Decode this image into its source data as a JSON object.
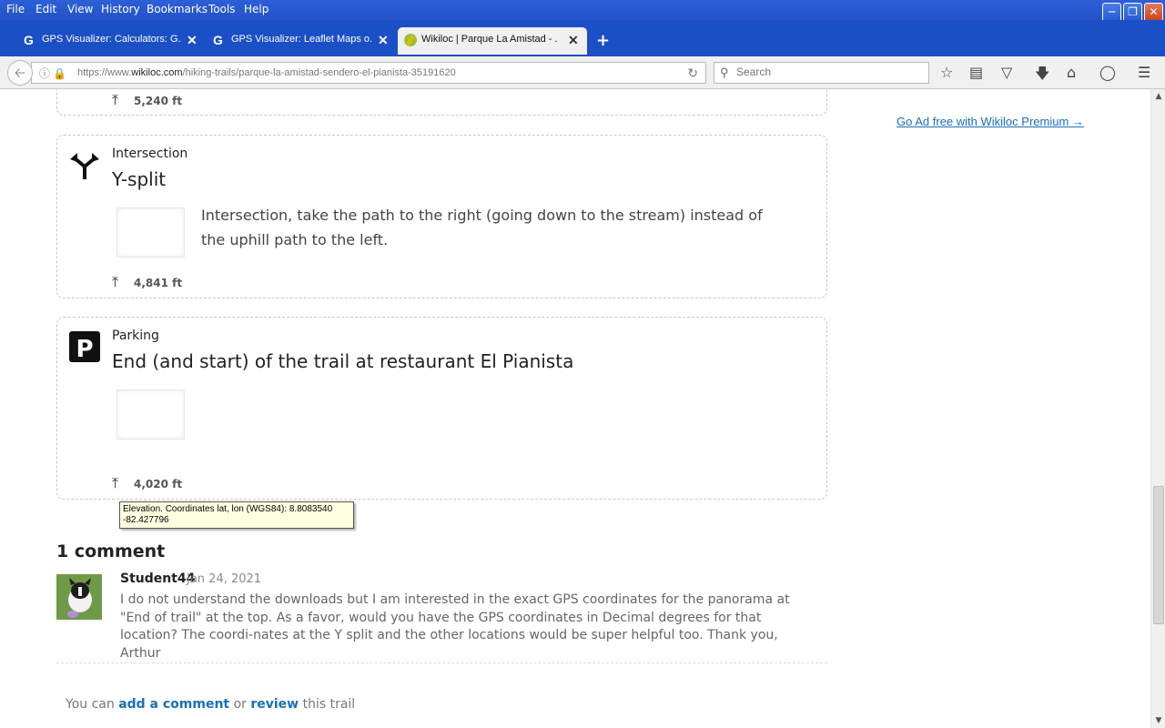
{
  "menu": {
    "file": "File",
    "edit": "Edit",
    "view": "View",
    "history": "History",
    "bookmarks": "Bookmarks",
    "tools": "Tools",
    "help": "Help"
  },
  "tabs": [
    {
      "label": "GPS Visualizer: Calculators: G...",
      "icon": "G"
    },
    {
      "label": "GPS Visualizer: Leaflet Maps o...",
      "icon": "G"
    },
    {
      "label": "Wikiloc | Parque La Amistad - ...",
      "icon": "wikiloc-icon"
    }
  ],
  "navbar": {
    "url_prefix": "https://www.",
    "url_domain": "wikiloc.com",
    "url_path": "/hiking-trails/parque-la-amistad-sendero-el-pianista-35191620",
    "search_placeholder": "Search"
  },
  "sidebar": {
    "premium_link": "Go Ad free with Wikiloc Premium →"
  },
  "waypoints": [
    {
      "elevation": "5,240 ft"
    },
    {
      "type": "Intersection",
      "title": "Y-split",
      "description": "Intersection, take the path to the right (going down to the stream) instead of the uphill path to the left.",
      "elevation": "4,841 ft",
      "icon": "intersection-icon"
    },
    {
      "type": "Parking",
      "title": "End (and start) of the trail at restaurant El Pianista",
      "elevation": "4,020 ft",
      "icon": "parking-icon"
    }
  ],
  "tooltip": {
    "line1": "Elevation. Coordinates lat, lon (WGS84): 8.8083540",
    "line2": "-82.427796"
  },
  "comments": {
    "title": "1 comment",
    "items": [
      {
        "author": "Student44",
        "date": "Jan 24, 2021",
        "body": "I do not understand the downloads but I am interested in the exact GPS coordinates for the panorama at \"End of trail\" at the top. As a favor, would you have the GPS coordinates in Decimal degrees for that location? The coordi-nates at the Y split and the other locations would be super helpful too. Thank you, Arthur"
      }
    ]
  },
  "cta": {
    "prefix": "You can",
    "add_comment": "add a comment",
    "or": "or",
    "review": "review",
    "suffix": "this trail"
  }
}
